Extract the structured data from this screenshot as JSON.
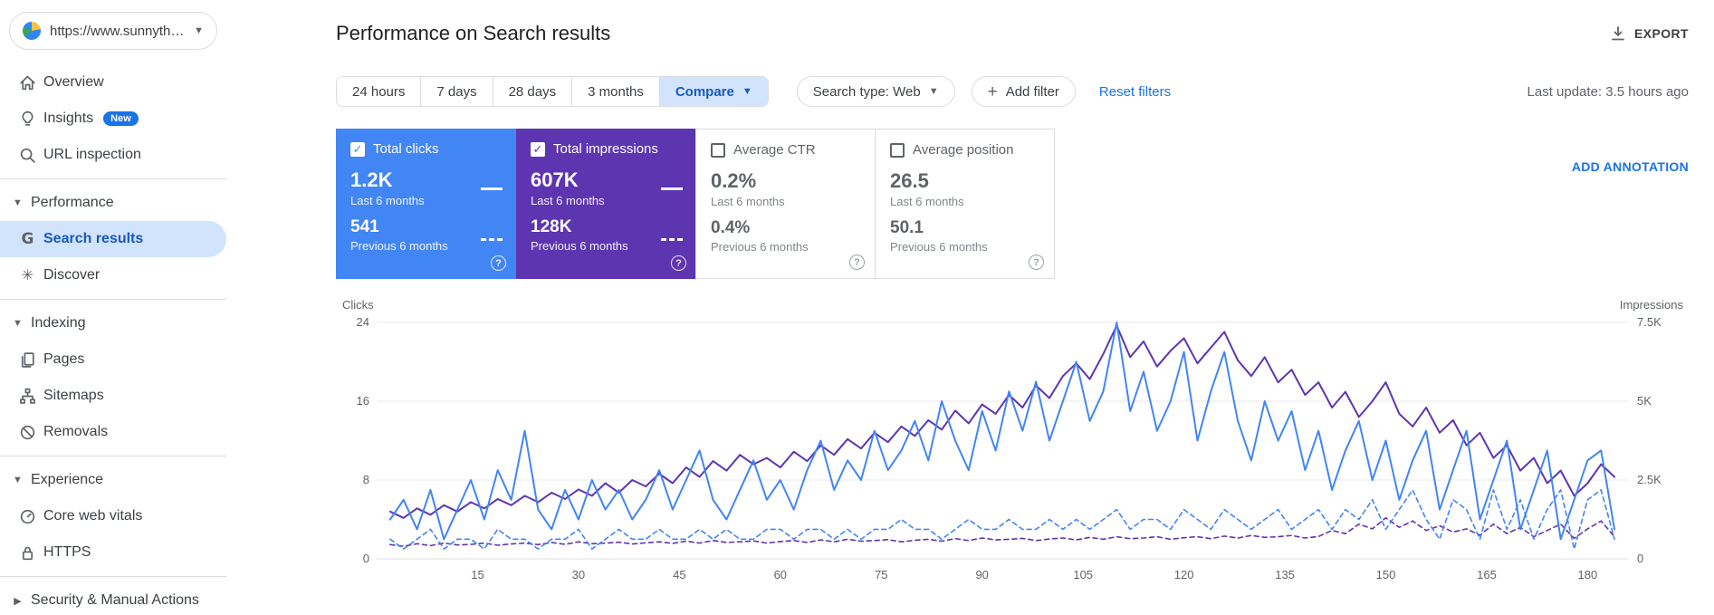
{
  "property_selector": {
    "label": "https://www.sunnythep...",
    "icon": "site-favicon"
  },
  "sidebar": {
    "overview": "Overview",
    "insights": "Insights",
    "insights_badge": "New",
    "url_inspection": "URL inspection",
    "performance": "Performance",
    "search_results": "Search results",
    "discover": "Discover",
    "indexing": "Indexing",
    "pages": "Pages",
    "sitemaps": "Sitemaps",
    "removals": "Removals",
    "experience": "Experience",
    "core_web_vitals": "Core web vitals",
    "https": "HTTPS",
    "security": "Security & Manual Actions"
  },
  "header": {
    "title": "Performance on Search results",
    "export_label": "EXPORT"
  },
  "filters": {
    "date_chips": {
      "d24h": "24 hours",
      "d7": "7 days",
      "d28": "28 days",
      "d3m": "3 months"
    },
    "compare_label": "Compare",
    "search_type_label": "Search type: Web",
    "add_filter_label": "Add filter",
    "reset_label": "Reset filters",
    "last_update": "Last update: 3.5 hours ago"
  },
  "annotation_label": "ADD ANNOTATION",
  "cards": [
    {
      "label": "Total clicks",
      "checked": true,
      "color": "#4285f4",
      "primary": "1.2K",
      "primary_caption": "Last 6 months",
      "secondary": "541",
      "secondary_caption": "Previous 6 months"
    },
    {
      "label": "Total impressions",
      "checked": true,
      "color": "#5e35b1",
      "primary": "607K",
      "primary_caption": "Last 6 months",
      "secondary": "128K",
      "secondary_caption": "Previous 6 months"
    },
    {
      "label": "Average CTR",
      "checked": false,
      "color": null,
      "primary": "0.2%",
      "primary_caption": "Last 6 months",
      "secondary": "0.4%",
      "secondary_caption": "Previous 6 months"
    },
    {
      "label": "Average position",
      "checked": false,
      "color": null,
      "primary": "26.5",
      "primary_caption": "Last 6 months",
      "secondary": "50.1",
      "secondary_caption": "Previous 6 months"
    }
  ],
  "chart_data": {
    "type": "line",
    "left_axis": {
      "label": "Clicks",
      "ticks": [
        0,
        8,
        16,
        24
      ],
      "max": 24
    },
    "right_axis": {
      "label": "Impressions",
      "ticks": [
        "0",
        "2.5K",
        "5K",
        "7.5K"
      ],
      "tick_values": [
        0,
        2500,
        5000,
        7500
      ],
      "max": 7500
    },
    "x_ticks": [
      15,
      30,
      45,
      60,
      75,
      90,
      105,
      120,
      135,
      150,
      165,
      180
    ],
    "x_max": 186,
    "x_start": 2,
    "x_step": 2,
    "grid": "horizontal",
    "series": [
      {
        "name": "Total impressions — Previous 6 months",
        "axis": "right",
        "style": "dashed",
        "color": "#5e35b1",
        "values": [
          450,
          400,
          480,
          420,
          500,
          440,
          460,
          500,
          430,
          470,
          500,
          450,
          520,
          460,
          540,
          480,
          500,
          530,
          470,
          510,
          540,
          490,
          560,
          500,
          580,
          520,
          540,
          570,
          500,
          550,
          580,
          520,
          600,
          540,
          620,
          560,
          580,
          610,
          540,
          590,
          620,
          560,
          640,
          580,
          660,
          600,
          620,
          650,
          580,
          630,
          660,
          600,
          680,
          620,
          700,
          640,
          660,
          700,
          620,
          670,
          700,
          640,
          720,
          660,
          740,
          680,
          700,
          740,
          660,
          710,
          900,
          800,
          1100,
          950,
          1300,
          1000,
          1200,
          900,
          1050,
          850,
          950,
          750,
          1100,
          800,
          1000,
          700,
          900,
          1100,
          650,
          950,
          1200,
          700
        ]
      },
      {
        "name": "Total clicks — Previous 6 months",
        "axis": "left",
        "style": "dashed",
        "color": "#4285f4",
        "values": [
          2,
          1,
          2,
          3,
          1,
          2,
          2,
          1,
          3,
          2,
          2,
          1,
          2,
          2,
          3,
          1,
          2,
          3,
          2,
          2,
          3,
          2,
          2,
          3,
          2,
          3,
          2,
          2,
          3,
          3,
          2,
          3,
          3,
          2,
          3,
          2,
          3,
          3,
          4,
          3,
          3,
          2,
          3,
          4,
          3,
          3,
          4,
          3,
          3,
          4,
          3,
          4,
          3,
          4,
          5,
          3,
          4,
          4,
          3,
          5,
          4,
          3,
          5,
          4,
          3,
          4,
          5,
          3,
          4,
          5,
          3,
          5,
          4,
          6,
          3,
          5,
          7,
          4,
          2,
          6,
          5,
          2,
          7,
          3,
          6,
          2,
          5,
          7,
          1,
          6,
          7,
          2
        ]
      },
      {
        "name": "Total impressions — Last 6 months",
        "axis": "right",
        "style": "solid",
        "color": "#5e35b1",
        "values": [
          1500,
          1300,
          1600,
          1400,
          1700,
          1500,
          1800,
          1600,
          1900,
          1700,
          2000,
          1800,
          2100,
          1900,
          2200,
          2000,
          2400,
          2100,
          2500,
          2300,
          2700,
          2400,
          2900,
          2600,
          3100,
          2800,
          3300,
          3000,
          3200,
          2900,
          3400,
          3100,
          3600,
          3300,
          3800,
          3500,
          4000,
          3700,
          4200,
          3900,
          4400,
          4100,
          4700,
          4300,
          4900,
          4600,
          5200,
          4800,
          5500,
          5100,
          5800,
          6200,
          5700,
          6500,
          7400,
          6400,
          6900,
          6100,
          6600,
          7000,
          6200,
          6700,
          7200,
          6300,
          5800,
          6400,
          5600,
          6000,
          5200,
          5600,
          4800,
          5300,
          4500,
          5000,
          5600,
          4600,
          4200,
          4800,
          4000,
          4400,
          3600,
          4000,
          3200,
          3600,
          2800,
          3200,
          2400,
          2800,
          2000,
          2400,
          3000,
          2600
        ]
      },
      {
        "name": "Total clicks — Last 6 months",
        "axis": "left",
        "style": "solid",
        "color": "#4285f4",
        "values": [
          4,
          6,
          3,
          7,
          2,
          5,
          8,
          4,
          9,
          6,
          13,
          5,
          3,
          7,
          4,
          8,
          5,
          7,
          4,
          6,
          9,
          5,
          8,
          11,
          6,
          4,
          7,
          10,
          6,
          8,
          5,
          9,
          12,
          7,
          10,
          8,
          13,
          9,
          11,
          14,
          10,
          16,
          12,
          9,
          15,
          11,
          17,
          13,
          18,
          12,
          16,
          20,
          14,
          17,
          24,
          15,
          19,
          13,
          16,
          21,
          12,
          17,
          21,
          14,
          10,
          16,
          12,
          15,
          9,
          13,
          7,
          11,
          14,
          8,
          12,
          6,
          10,
          13,
          5,
          9,
          13,
          4,
          8,
          12,
          3,
          7,
          11,
          2,
          6,
          10,
          11,
          3
        ]
      }
    ]
  }
}
